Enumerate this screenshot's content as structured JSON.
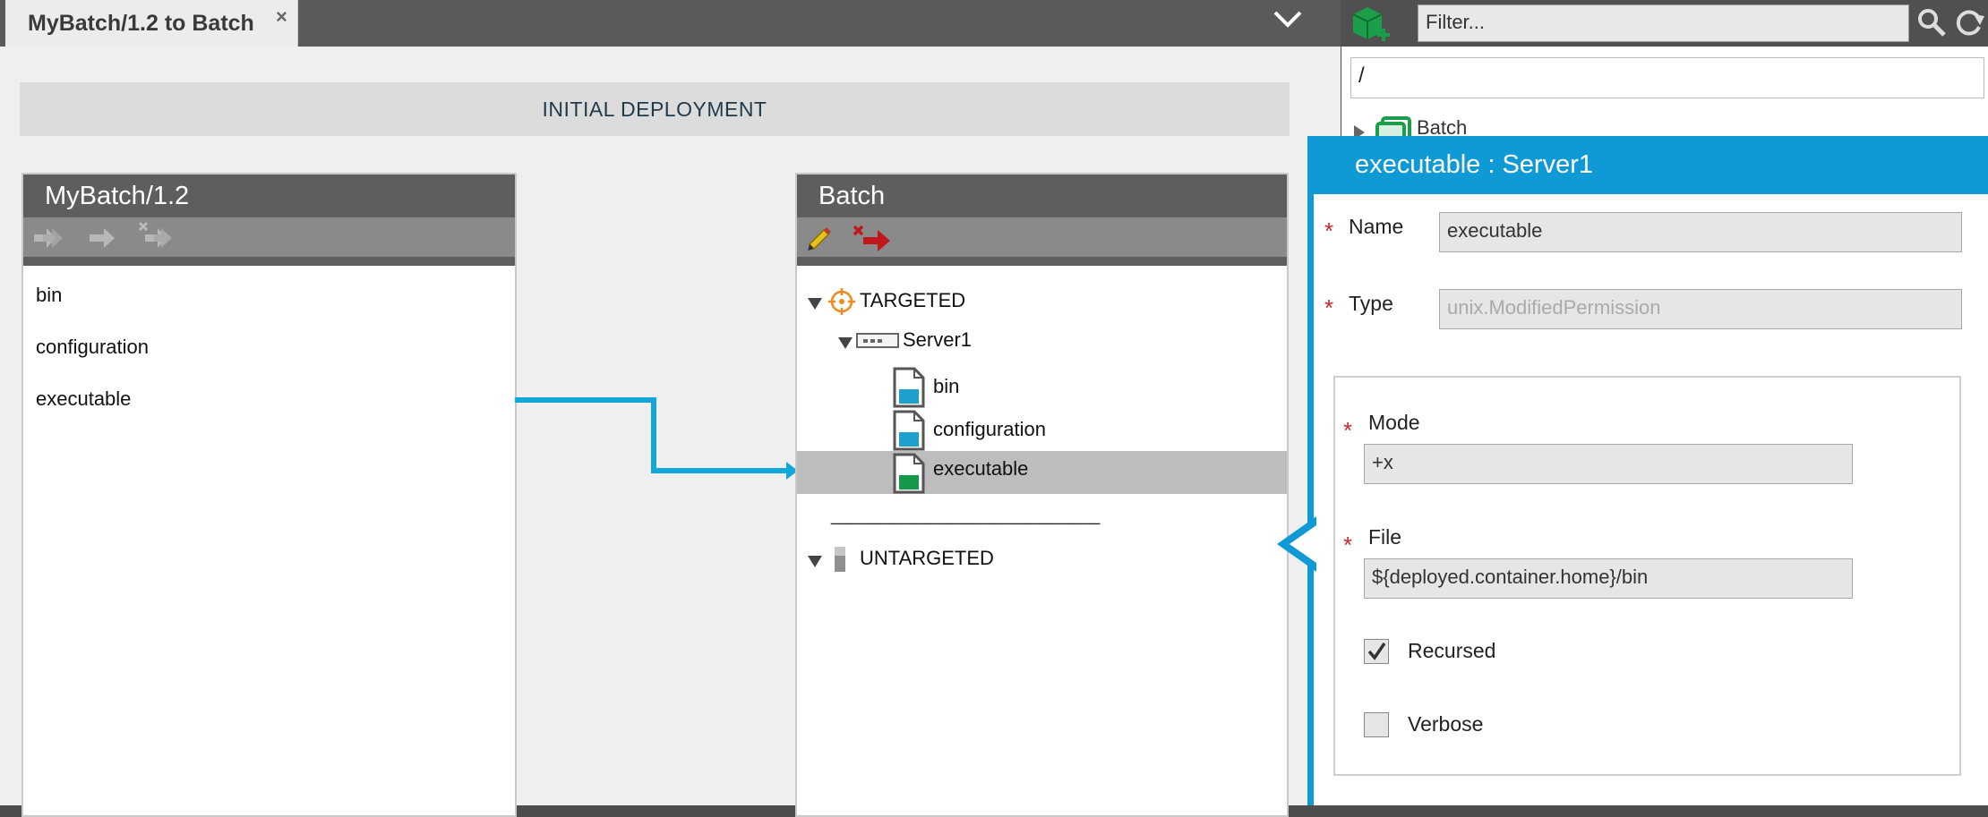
{
  "tab": {
    "title": "MyBatch/1.2 to Batch",
    "close": "×"
  },
  "banner": {
    "label": "INITIAL DEPLOYMENT"
  },
  "left_panel": {
    "title": "MyBatch/1.2",
    "items": [
      "bin",
      "configuration",
      "executable"
    ]
  },
  "right_panel": {
    "title": "Batch",
    "tree": {
      "targeted": "TARGETED",
      "server": "Server1",
      "children": [
        "bin",
        "configuration",
        "executable"
      ],
      "separator": "___________________________",
      "untargeted": "UNTARGETED"
    }
  },
  "library": {
    "filter_placeholder": "Filter...",
    "path": "/",
    "batch_item": "Batch"
  },
  "detail": {
    "title": "executable : Server1",
    "name_label": "Name",
    "name_value": "executable",
    "type_label": "Type",
    "type_value": "unix.ModifiedPermission",
    "mode_label": "Mode",
    "mode_value": "+x",
    "file_label": "File",
    "file_value": "${deployed.container.home}/bin",
    "recursed_label": "Recursed",
    "recursed_checked": true,
    "verbose_label": "Verbose",
    "verbose_checked": false,
    "required_mark": "*"
  },
  "colors": {
    "accent": "#0f9ad6",
    "required": "#c8282c",
    "header": "#5e5e5e"
  }
}
